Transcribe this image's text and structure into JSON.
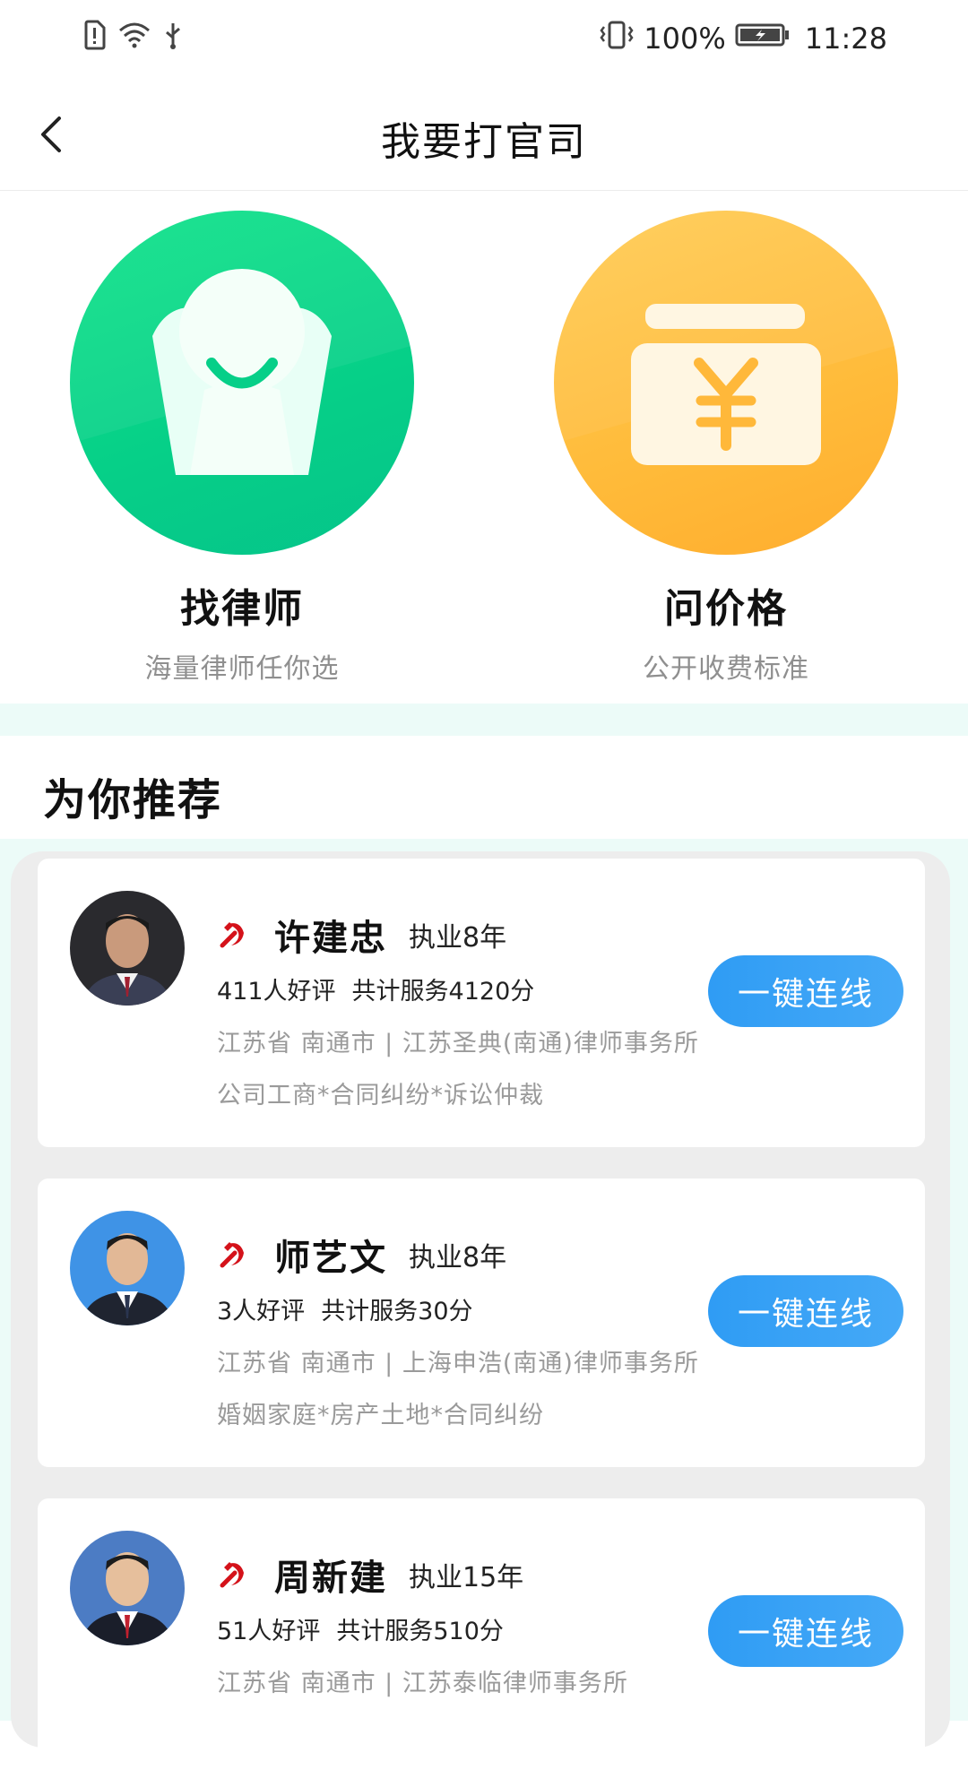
{
  "status_bar": {
    "battery": "100%",
    "time": "11:28"
  },
  "header": {
    "title": "我要打官司"
  },
  "actions": [
    {
      "title": "找律师",
      "subtitle": "海量律师任你选"
    },
    {
      "title": "问价格",
      "subtitle": "公开收费标准"
    }
  ],
  "recommend": {
    "title": "为你推荐"
  },
  "lawyers": [
    {
      "name": "许建忠",
      "years": "执业8年",
      "reviews": "411人好评",
      "service": "共计服务4120分",
      "location": "江苏省  南通市 | 江苏圣典(南通)律师事务所",
      "fields": "公司工商*合同纠纷*诉讼仲裁",
      "button": "一键连线"
    },
    {
      "name": "师艺文",
      "years": "执业8年",
      "reviews": "3人好评",
      "service": "共计服务30分",
      "location": "江苏省  南通市 | 上海申浩(南通)律师事务所",
      "fields": "婚姻家庭*房产土地*合同纠纷",
      "button": "一键连线"
    },
    {
      "name": "周新建",
      "years": "执业15年",
      "reviews": "51人好评",
      "service": "共计服务510分",
      "location": "江苏省  南通市 | 江苏泰临律师事务所",
      "fields": "",
      "button": "一键连线"
    }
  ],
  "colors": {
    "green": "#06cf88",
    "orange": "#ffbb3a",
    "blue": "#2f9cf4",
    "mint": "#ecfbf8"
  }
}
